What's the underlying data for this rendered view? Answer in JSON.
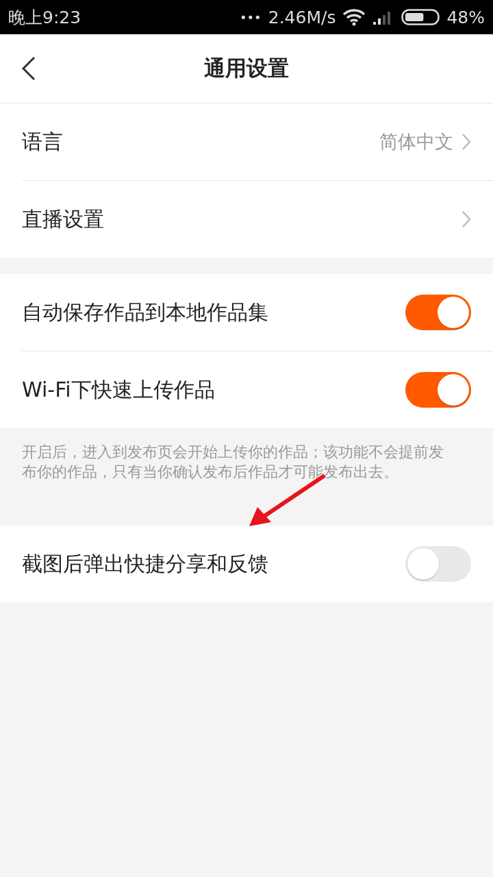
{
  "status_bar": {
    "time": "晚上9:23",
    "dots": "•••",
    "speed": "2.46M/s",
    "battery_percent": "48%",
    "battery": {
      "level": 0.6
    }
  },
  "header": {
    "title": "通用设置"
  },
  "sections": [
    {
      "rows": [
        {
          "kind": "link",
          "label": "语言",
          "value": "简体中文"
        },
        {
          "kind": "link",
          "label": "直播设置"
        }
      ]
    },
    {
      "rows": [
        {
          "kind": "toggle",
          "label": "自动保存作品到本地作品集",
          "on": true
        },
        {
          "kind": "toggle",
          "label": "Wi-Fi下快速上传作品",
          "on": true
        }
      ],
      "note": "开启后，进入到发布页会开始上传你的作品；该功能不会提前发布你的作品，只有当你确认发布后作品才可能发布出去。"
    },
    {
      "rows": [
        {
          "kind": "toggle",
          "label": "截图后弹出快捷分享和反馈",
          "on": false
        }
      ]
    }
  ]
}
